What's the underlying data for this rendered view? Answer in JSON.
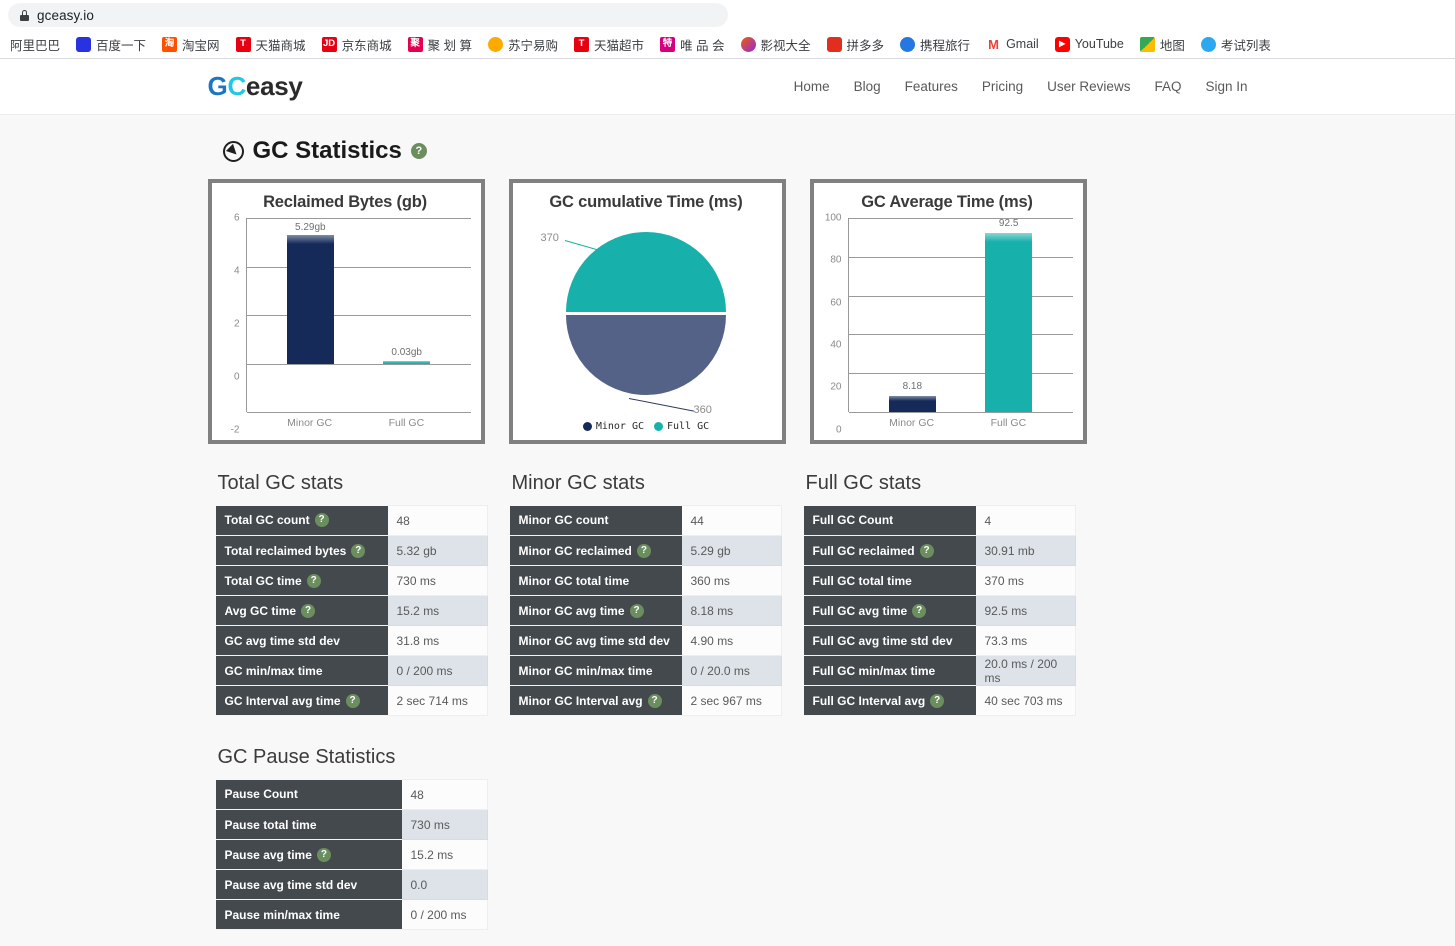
{
  "browser": {
    "url": "gceasy.io",
    "lock_icon": "lock-icon",
    "bookmarks": [
      {
        "label": "阿里巴巴",
        "icon": "alibaba-favicon"
      },
      {
        "label": "百度一下",
        "icon": "baidu-favicon"
      },
      {
        "label": "淘宝网",
        "icon": "taobao-favicon",
        "glyph": "淘"
      },
      {
        "label": "天猫商城",
        "icon": "tmall-favicon",
        "glyph": "T"
      },
      {
        "label": "京东商城",
        "icon": "jd-favicon",
        "glyph": "JD"
      },
      {
        "label": "聚 划 算",
        "icon": "juhuasuan-favicon",
        "glyph": "聚"
      },
      {
        "label": "苏宁易购",
        "icon": "suning-favicon"
      },
      {
        "label": "天猫超市",
        "icon": "tmall-supermarket-favicon",
        "glyph": "T"
      },
      {
        "label": "唯 品 会",
        "icon": "vip-favicon",
        "glyph": "特"
      },
      {
        "label": "影视大全",
        "icon": "yingshidaquan-favicon"
      },
      {
        "label": "拼多多",
        "icon": "pinduoduo-favicon"
      },
      {
        "label": "携程旅行",
        "icon": "ctrip-favicon"
      },
      {
        "label": "Gmail",
        "icon": "gmail-favicon",
        "glyph": "M"
      },
      {
        "label": "YouTube",
        "icon": "youtube-favicon",
        "glyph": "▶"
      },
      {
        "label": "地图",
        "icon": "maps-favicon"
      },
      {
        "label": "考试列表",
        "icon": "exam-list-favicon"
      }
    ]
  },
  "site": {
    "brand": {
      "part1": "G",
      "part2": "C",
      "part3": "easy"
    },
    "nav": [
      {
        "label": "Home"
      },
      {
        "label": "Blog"
      },
      {
        "label": "Features"
      },
      {
        "label": "Pricing"
      },
      {
        "label": "User Reviews"
      },
      {
        "label": "FAQ"
      },
      {
        "label": "Sign In"
      }
    ]
  },
  "page": {
    "section_title": "GC Statistics",
    "section_icon": "compass-icon",
    "help_glyph": "?"
  },
  "colors": {
    "navy": "#152a58",
    "teal": "#17b0ab",
    "slate": "#546287",
    "header_cell": "#44494d",
    "help_green": "#6b8e5e",
    "brand_blue": "#1c77c3",
    "brand_cyan": "#1ec8e6"
  },
  "chart_data": [
    {
      "type": "bar",
      "title": "Reclaimed Bytes (gb)",
      "categories": [
        "Minor GC",
        "Full GC"
      ],
      "values": [
        5.29,
        0.03
      ],
      "data_labels": [
        "5.29gb",
        "0.03gb"
      ],
      "colors": [
        "#152a58",
        "#17b0ab"
      ],
      "ylim": [
        -2,
        6
      ],
      "yticks": [
        6,
        4,
        2,
        0,
        -2
      ],
      "xlabel": "",
      "ylabel": "",
      "grid": true,
      "legend": "none"
    },
    {
      "type": "pie",
      "title": "GC cumulative Time (ms)",
      "categories": [
        "Minor GC",
        "Full GC"
      ],
      "values": [
        360,
        370
      ],
      "data_labels": [
        "360",
        "370"
      ],
      "colors": [
        "#546287",
        "#17b0ab"
      ],
      "legend": "bottom",
      "legend_entries": [
        "Minor GC",
        "Full GC"
      ]
    },
    {
      "type": "bar",
      "title": "GC Average Time (ms)",
      "categories": [
        "Minor GC",
        "Full GC"
      ],
      "values": [
        8.18,
        92.5
      ],
      "data_labels": [
        "8.18",
        "92.5"
      ],
      "colors": [
        "#152a58",
        "#17b0ab"
      ],
      "ylim": [
        0,
        100
      ],
      "yticks": [
        100,
        80,
        60,
        40,
        20,
        0
      ],
      "xlabel": "",
      "ylabel": "",
      "grid": true,
      "legend": "none"
    }
  ],
  "tables": {
    "total": {
      "title": "Total GC stats",
      "rows": [
        {
          "key": "Total GC count",
          "help": true,
          "value": "48"
        },
        {
          "key": "Total reclaimed bytes",
          "help": true,
          "value": "5.32 gb"
        },
        {
          "key": "Total GC time",
          "help": true,
          "value": "730 ms"
        },
        {
          "key": "Avg GC time",
          "help": true,
          "value": "15.2 ms"
        },
        {
          "key": "GC avg time std dev",
          "help": false,
          "value": "31.8 ms"
        },
        {
          "key": "GC min/max time",
          "help": false,
          "value": "0 / 200 ms"
        },
        {
          "key": "GC Interval avg time",
          "help": true,
          "value": "2 sec 714 ms"
        }
      ]
    },
    "minor": {
      "title": "Minor GC stats",
      "rows": [
        {
          "key": "Minor GC count",
          "help": false,
          "value": "44"
        },
        {
          "key": "Minor GC reclaimed",
          "help": true,
          "value": "5.29 gb"
        },
        {
          "key": "Minor GC total time",
          "help": false,
          "value": "360 ms"
        },
        {
          "key": "Minor GC avg time",
          "help": true,
          "value": "8.18 ms"
        },
        {
          "key": "Minor GC avg time std dev",
          "help": false,
          "value": "4.90 ms"
        },
        {
          "key": "Minor GC min/max time",
          "help": false,
          "value": "0 / 20.0 ms"
        },
        {
          "key": "Minor GC Interval avg",
          "help": true,
          "value": "2 sec 967 ms"
        }
      ]
    },
    "full": {
      "title": "Full GC stats",
      "rows": [
        {
          "key": "Full GC Count",
          "help": false,
          "value": "4"
        },
        {
          "key": "Full GC reclaimed",
          "help": true,
          "value": "30.91 mb"
        },
        {
          "key": "Full GC total time",
          "help": false,
          "value": "370 ms"
        },
        {
          "key": "Full GC avg time",
          "help": true,
          "value": "92.5 ms"
        },
        {
          "key": "Full GC avg time std dev",
          "help": false,
          "value": "73.3 ms"
        },
        {
          "key": "Full GC min/max time",
          "help": false,
          "value": "20.0 ms / 200 ms"
        },
        {
          "key": "Full GC Interval avg",
          "help": true,
          "value": "40 sec 703 ms"
        }
      ]
    },
    "pause": {
      "title": "GC Pause Statistics",
      "rows": [
        {
          "key": "Pause Count",
          "help": false,
          "value": "48"
        },
        {
          "key": "Pause total time",
          "help": false,
          "value": "730 ms"
        },
        {
          "key": "Pause avg time",
          "help": true,
          "value": "15.2 ms"
        },
        {
          "key": "Pause avg time std dev",
          "help": false,
          "value": "0.0"
        },
        {
          "key": "Pause min/max time",
          "help": false,
          "value": "0 / 200 ms"
        }
      ]
    }
  }
}
